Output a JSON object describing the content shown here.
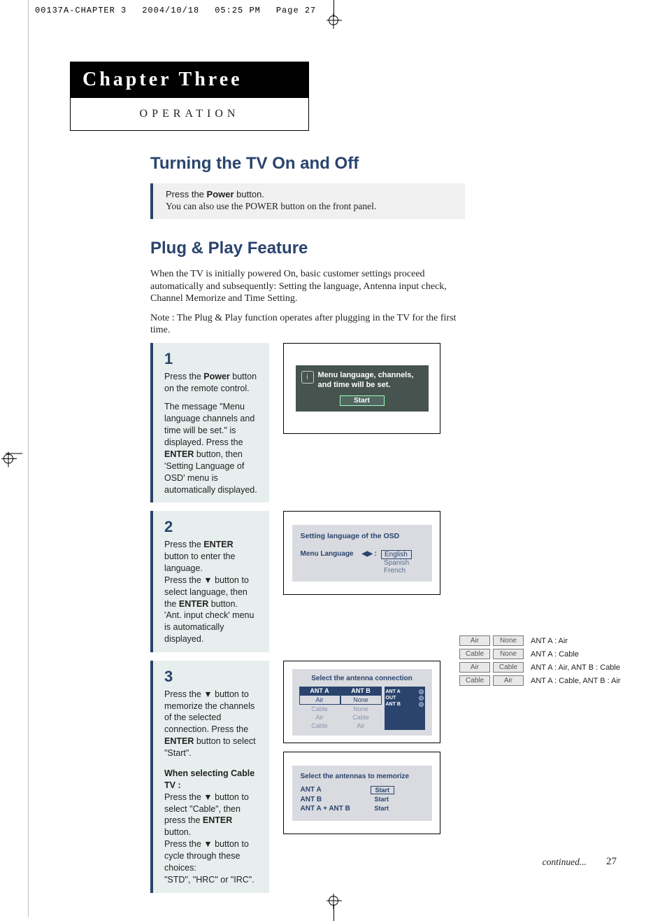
{
  "print_meta": {
    "file": "00137A-CHAPTER 3",
    "date": "2004/10/18",
    "time": "05:25 PM",
    "page": "Page 27"
  },
  "chapter": {
    "title": "Chapter Three",
    "subtitle": "OPERATION"
  },
  "section1": {
    "heading": "Turning the TV On and Off",
    "line1_prefix": "Press the ",
    "line1_bold": "Power",
    "line1_suffix": " button.",
    "line2": "You can also use the POWER button on the front panel."
  },
  "section2": {
    "heading": "Plug & Play Feature",
    "desc": "When the TV is initially powered On, basic customer settings proceed automatically and subsequently: Setting the language, Antenna input check, Channel Memorize and Time Setting.",
    "note": "Note : The Plug & Play function operates after plugging in the TV for the first time."
  },
  "steps": {
    "s1": {
      "num": "1",
      "p1a": "Press the ",
      "p1b": "Power",
      "p1c": " button on the remote control.",
      "p2a": "The message \"Menu language channels and time will be set.\" is displayed. Press the ",
      "p2b": "ENTER",
      "p2c": " button, then 'Setting Language of OSD' menu is automatically displayed.",
      "osd_text": "Menu language, channels, and time will be set.",
      "osd_btn": "Start"
    },
    "s2": {
      "num": "2",
      "p1a": "Press the ",
      "p1b": "ENTER",
      "p1c": " button to enter the language.",
      "p2a": "Press the ▼ button to select language, then the ",
      "p2b": "ENTER",
      "p2c": " button.",
      "p3": "'Ant. input check' menu is automatically displayed.",
      "osd_title": "Setting language of the OSD",
      "osd_label": "Menu Language",
      "osd_icon": "◀▶ :",
      "opts": [
        "English",
        "Spanish",
        "French"
      ]
    },
    "s3": {
      "num": "3",
      "p1a": "Press the ▼ button to memorize the channels of the selected connection. Press the ",
      "p1b": "ENTER",
      "p1c": " button to select \"Start\".",
      "cable_head": "When selecting Cable TV :",
      "cable_a": "Press the ▼ button to select \"Cable\", then press the ",
      "cable_b": "ENTER",
      "cable_c": " button.",
      "cable_d": "Press the ▼ button to cycle through these choices:",
      "cable_e": "\"STD\", \"HRC\" or \"IRC\".",
      "osd3_title": "Select the antenna connection",
      "osd3_hdr": [
        "ANT A",
        "ANT B"
      ],
      "osd3_rows": [
        [
          "Air",
          "None"
        ],
        [
          "Cable",
          "None"
        ],
        [
          "Air",
          "Cable"
        ],
        [
          "Cable",
          "Air"
        ]
      ],
      "diagram": {
        "slots": [
          "ANT A",
          "OUT",
          "ANT B"
        ]
      },
      "osd4_title": "Select the antennas to memorize",
      "osd4_rows": [
        {
          "l": "ANT A",
          "b": "Start"
        },
        {
          "l": "ANT B",
          "b": "Start"
        },
        {
          "l": "ANT A + ANT B",
          "b": "Start"
        }
      ]
    }
  },
  "legend": [
    {
      "a": "Air",
      "b": "None",
      "label": "ANT A : Air"
    },
    {
      "a": "Cable",
      "b": "None",
      "label": "ANT A : Cable"
    },
    {
      "a": "Air",
      "b": "Cable",
      "label": "ANT A : Air, ANT B : Cable"
    },
    {
      "a": "Cable",
      "b": "Air",
      "label": "ANT A : Cable, ANT B : Air"
    }
  ],
  "footer": {
    "continued": "continued...",
    "pageno": "27"
  }
}
